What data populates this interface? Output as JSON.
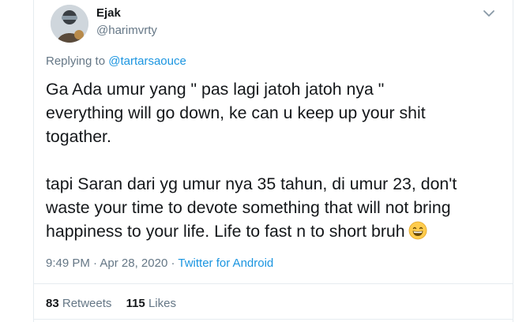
{
  "user": {
    "display_name": "Ejak",
    "handle": "@harimvrty"
  },
  "reply": {
    "prefix": "Replying to",
    "to": "@tartarsaouce"
  },
  "tweet": {
    "paragraph1": "Ga Ada umur yang \" pas lagi jatoh jatoh nya \"\neverything will go down, ke can u keep up your shit\ntogather.",
    "paragraph2": "tapi Saran dari yg umur nya 35 tahun, di umur 23, don't\nwaste your time to devote something that will not bring\nhappiness to your life. Life to fast n to short bruh",
    "emoji": "grinning-face-with-smiling-eyes"
  },
  "meta": {
    "time": "9:49 PM",
    "sep1": "·",
    "date": "Apr 28, 2020",
    "sep2": "·",
    "source": "Twitter for Android"
  },
  "stats": {
    "retweets_count": "83",
    "retweets_label": "Retweets",
    "likes_count": "115",
    "likes_label": "Likes"
  },
  "colors": {
    "link": "#1b95e0",
    "muted": "#657786",
    "text": "#14171a",
    "border": "#e6ecf0"
  }
}
